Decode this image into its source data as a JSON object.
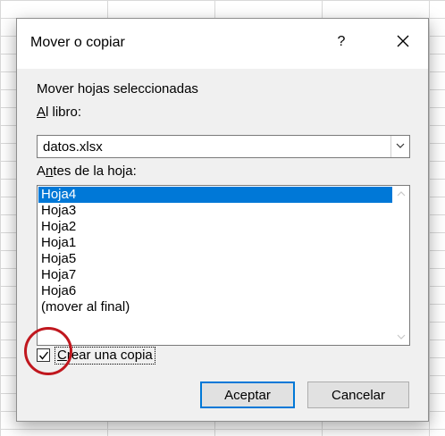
{
  "dialog": {
    "title": "Mover o copiar",
    "help_label": "?",
    "move_sheets_label": "Mover hojas seleccionadas",
    "to_book_label": {
      "accel": "A",
      "rest": "l libro:"
    },
    "book_value": "datos.xlsx",
    "before_sheet_label": {
      "pre": "A",
      "accel": "n",
      "rest": "tes de la hoja:"
    },
    "sheets": [
      {
        "label": "Hoja4",
        "selected": true
      },
      {
        "label": "Hoja3"
      },
      {
        "label": "Hoja2"
      },
      {
        "label": "Hoja1"
      },
      {
        "label": "Hoja5"
      },
      {
        "label": "Hoja7"
      },
      {
        "label": "Hoja6"
      },
      {
        "label": "(mover al final)"
      }
    ],
    "create_copy": {
      "accel": "C",
      "rest": "rear una copia",
      "checked": true
    },
    "ok_label": "Aceptar",
    "cancel_label": "Cancelar"
  },
  "colors": {
    "selection": "#0078d7",
    "highlight_circle": "#c0171e"
  }
}
